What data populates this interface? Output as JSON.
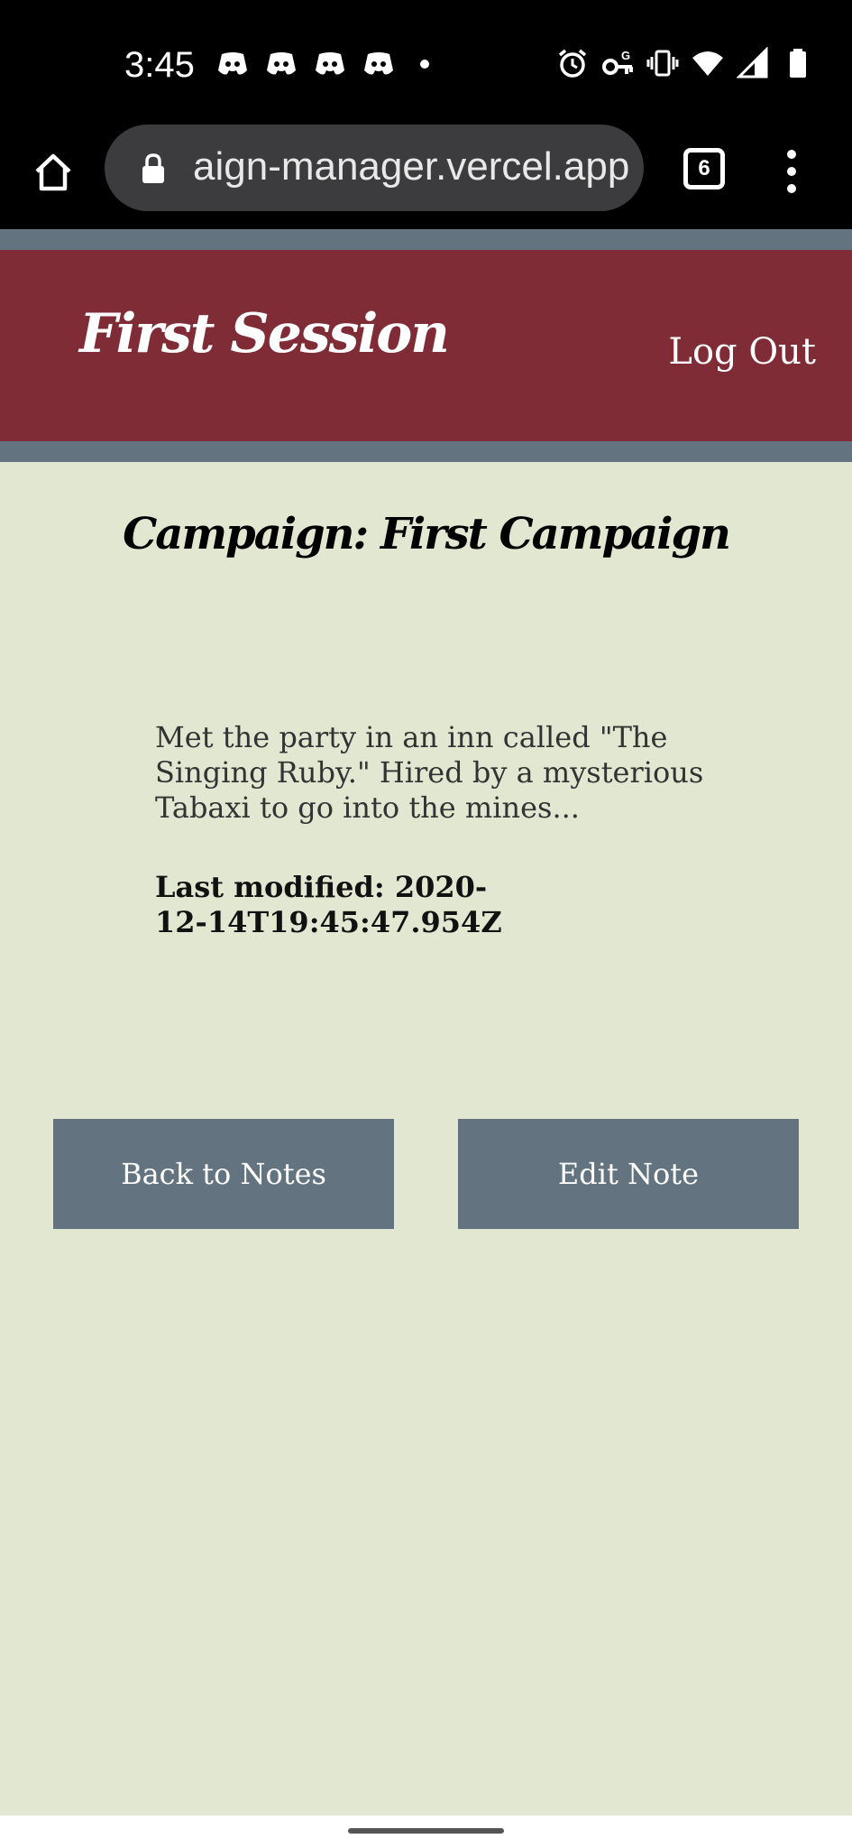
{
  "status_bar": {
    "time": "3:45",
    "notification_icons": [
      "discord-icon",
      "discord-icon",
      "discord-icon",
      "discord-icon"
    ],
    "system_icons": [
      "alarm-icon",
      "vpn-key-icon",
      "vibrate-icon",
      "wifi-icon",
      "signal-icon",
      "battery-icon"
    ]
  },
  "browser": {
    "url": "aign-manager.vercel.app",
    "tab_count": "6"
  },
  "header": {
    "brand": "First Session",
    "logout_label": "Log Out"
  },
  "main": {
    "campaign_title": "Campaign: First Campaign",
    "note_text": "Met the party in an inn called \"The Singing Ruby.\" Hired by a mysterious Tabaxi to go into the mines...",
    "last_modified": "Last modified: 2020-12-14T19:45:47.954Z",
    "back_button_label": "Back to Notes",
    "edit_button_label": "Edit Note"
  },
  "colors": {
    "header_bg": "#7f2c37",
    "stripe": "#63737f",
    "page_bg": "#e2e7d1",
    "button_bg": "#63737f"
  }
}
